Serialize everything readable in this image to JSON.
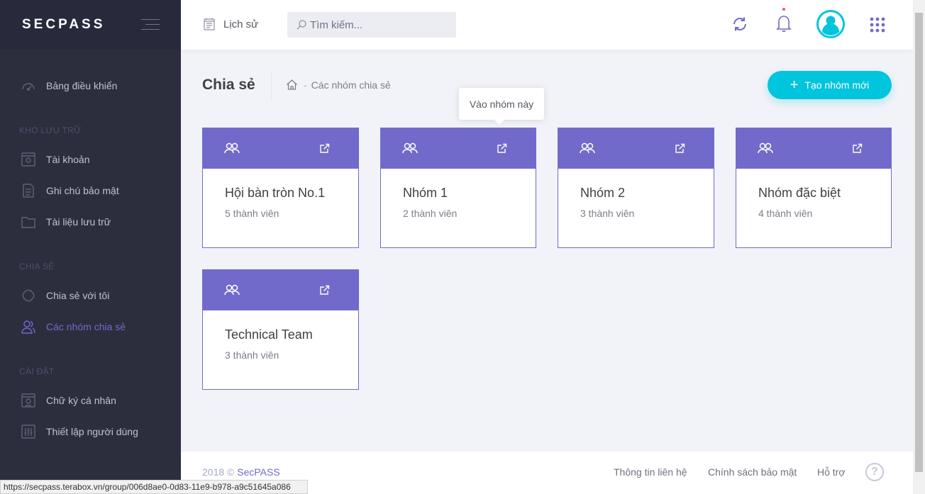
{
  "app": {
    "brand": "SECPASS"
  },
  "sidebar": {
    "items": [
      {
        "label": "Bảng điều khiển",
        "icon": "dashboard-icon"
      },
      {
        "label": "Tài khoản",
        "icon": "account-icon"
      },
      {
        "label": "Ghi chú bảo mật",
        "icon": "note-icon"
      },
      {
        "label": "Tài liệu lưu trữ",
        "icon": "folder-icon"
      },
      {
        "label": "Chia sẻ với tôi",
        "icon": "share-icon"
      },
      {
        "label": "Các nhóm chia sẻ",
        "icon": "users-icon",
        "active": true
      },
      {
        "label": "Chữ ký cá nhân",
        "icon": "signature-icon"
      },
      {
        "label": "Thiết lập người dùng",
        "icon": "settings-icon"
      }
    ],
    "sections": [
      "KHO LƯU TRỮ",
      "CHIA SẺ",
      "CÀI ĐẶT"
    ]
  },
  "header": {
    "history_label": "Lịch sử",
    "search_placeholder": "Tìm kiếm..."
  },
  "page": {
    "title": "Chia sẻ",
    "breadcrumb": "Các nhóm chia sẻ",
    "create_button": "Tạo nhóm mới",
    "tooltip": "Vào nhóm này"
  },
  "groups": [
    {
      "name": "Hội bàn tròn No.1",
      "members": "5 thành viên"
    },
    {
      "name": "Nhóm 1",
      "members": "2 thành viên"
    },
    {
      "name": "Nhóm 2",
      "members": "3 thành viên"
    },
    {
      "name": "Nhóm đặc biệt",
      "members": "4 thành viên"
    },
    {
      "name": "Technical Team",
      "members": "3 thành viên"
    }
  ],
  "footer": {
    "year": "2018 ©",
    "brand": "SecPASS",
    "links": [
      "Thông tin liên hệ",
      "Chính sách bảo mật",
      "Hỗ trợ"
    ],
    "help": "?"
  },
  "status_url": "https://secpass.terabox.vn/group/006d8ae0-0d83-11e9-b978-a9c51645a086",
  "colors": {
    "sidebar": "#2c2e3e",
    "accent": "#716aca",
    "button": "#00c5dc",
    "alert": "#f4516c"
  }
}
